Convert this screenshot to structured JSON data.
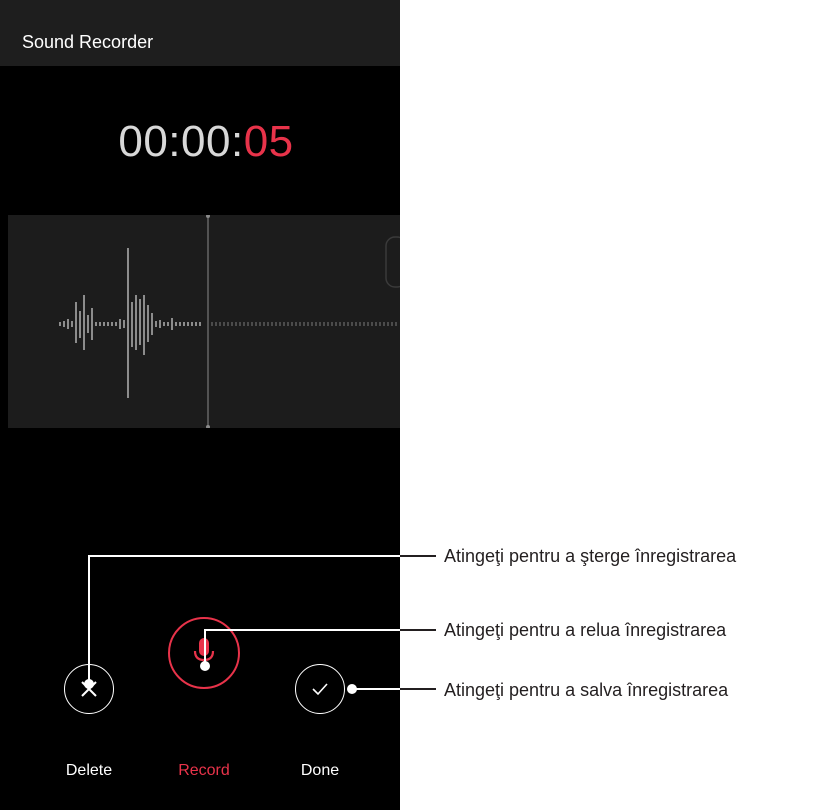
{
  "app": {
    "title": "Sound Recorder"
  },
  "timer": {
    "elapsed_prefix": "00:00:",
    "elapsed_seconds": "05"
  },
  "controls": {
    "delete_label": "Delete",
    "record_label": "Record",
    "done_label": "Done"
  },
  "callouts": {
    "delete": "Atingeţi pentru a şterge înregistrarea",
    "record": "Atingeţi pentru a relua înregistrarea",
    "done": "Atingeţi pentru a salva înregistrarea"
  },
  "icons": {
    "delete": "close-icon",
    "record": "microphone-icon",
    "done": "checkmark-icon"
  },
  "colors": {
    "accent": "#e8334a",
    "background": "#000000",
    "titlebar": "#1e1e1e",
    "waveform_panel": "#1c1c1c",
    "callout_line": "#231f20"
  }
}
